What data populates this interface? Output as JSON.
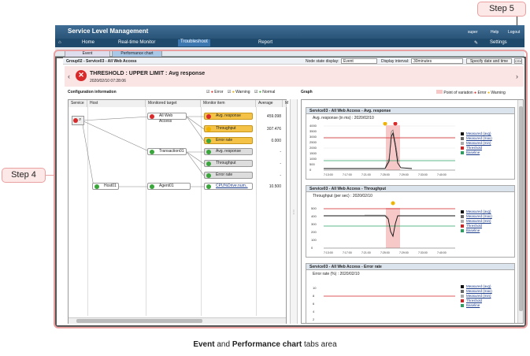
{
  "app_title": "Service Level Management",
  "top_right": {
    "user": "super",
    "help": "Help",
    "logout": "Logout"
  },
  "menu": {
    "home": "Home",
    "realtime": "Real-time Monitor",
    "troubleshoot": "Troubleshoot",
    "report": "Report",
    "settings": "Settings"
  },
  "tabs": {
    "event": "Event",
    "performance": "Performance chart"
  },
  "breadcrumb": "Group02 - Service03 - All Web Access",
  "controls": {
    "node_state_label": "Node state display:",
    "node_state_value": "Event",
    "interval_label": "Display interval:",
    "interval_value": "30minutes",
    "specify_button": "Specify date and time",
    "export_button": "CSV"
  },
  "alert": {
    "title": "THRESHOLD : UPPER LIMIT : Avg response",
    "timestamp": "2020/02/10 07:28:06"
  },
  "config": {
    "title": "Configuration information",
    "filters": {
      "error": "Error",
      "warning": "Warning",
      "normal": "Normal"
    },
    "columns": {
      "service": "Service",
      "host": "Host",
      "target": "Monitored target",
      "item": "Monitor item",
      "average": "Average",
      "more": "M"
    },
    "host": "Host01",
    "targets": {
      "all_web": "All Web Access",
      "transaction": "Transaction01",
      "agent": "Agent01"
    },
    "items": [
      {
        "name": "Avg. response",
        "value": "459.098"
      },
      {
        "name": "Throughput",
        "value": "307.476"
      },
      {
        "name": "Error rate",
        "value": "0.000"
      },
      {
        "name": "Avg. response",
        "value": "-"
      },
      {
        "name": "Throughput",
        "value": "-"
      },
      {
        "name": "Error rate",
        "value": "-"
      },
      {
        "name": "CPU%Drive.num..",
        "value": "10.500"
      }
    ]
  },
  "graph_panel": {
    "title": "Graph",
    "legend": {
      "point": "Point of variation",
      "error": "Error",
      "warning": "Warning"
    }
  },
  "graphs": [
    {
      "title": "Service03 - All Web Access - Avg. response",
      "subtitle": "Avg. response (in ms) : 2020/02/10",
      "y_ticks": [
        "4000",
        "3500",
        "3000",
        "2500",
        "2000",
        "1500",
        "1000",
        "500",
        "0"
      ]
    },
    {
      "title": "Service03 - All Web Access - Throughput",
      "subtitle": "Throughput (per sec) : 2020/02/10",
      "y_ticks": [
        "500",
        "400",
        "300",
        "200",
        "100",
        "0"
      ]
    },
    {
      "title": "Service03 - All Web Access - Error rate",
      "subtitle": "Error rate (%) : 2020/02/10",
      "y_ticks": [
        "10",
        "8",
        "6",
        "4",
        "2",
        "0"
      ]
    }
  ],
  "x_ticks": [
    "7:13:00",
    "7:17:00",
    "7:21:00",
    "7:25:00",
    "7:29:00",
    "7:33:00",
    "7:40:00"
  ],
  "legend_items": [
    {
      "label": "Measured (avg)",
      "color": "#111111"
    },
    {
      "label": "Measured (max)",
      "color": "#666666"
    },
    {
      "label": "Measured (min)",
      "color": "#aaaaaa"
    },
    {
      "label": "Threshold",
      "color": "#d42020"
    },
    {
      "label": "Baseline",
      "color": "#2aa060"
    }
  ],
  "callouts": {
    "step4": "Step 4",
    "step5": "Step 5"
  },
  "caption": {
    "part1": "Event",
    "and": " and ",
    "part2": "Performance chart",
    "rest": " tabs area"
  }
}
